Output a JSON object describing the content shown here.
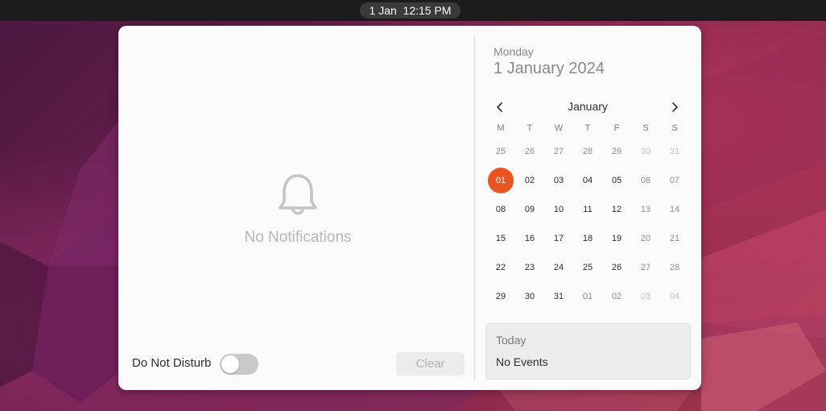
{
  "topbar": {
    "clock": "1 Jan  12:15 PM"
  },
  "notifications": {
    "empty_text": "No Notifications",
    "dnd_label": "Do Not Disturb",
    "dnd_enabled": false,
    "clear_label": "Clear"
  },
  "calendar": {
    "day_name": "Monday",
    "full_date": "1 January 2024",
    "month": "January",
    "weekdays": [
      "M",
      "T",
      "W",
      "T",
      "F",
      "S",
      "S"
    ],
    "weeks": [
      [
        "25",
        "26",
        "27",
        "28",
        "29",
        "30",
        "31"
      ],
      [
        "01",
        "02",
        "03",
        "04",
        "05",
        "06",
        "07"
      ],
      [
        "08",
        "09",
        "10",
        "11",
        "12",
        "13",
        "14"
      ],
      [
        "15",
        "16",
        "17",
        "18",
        "19",
        "20",
        "21"
      ],
      [
        "22",
        "23",
        "24",
        "25",
        "26",
        "27",
        "28"
      ],
      [
        "29",
        "30",
        "31",
        "01",
        "02",
        "03",
        "04"
      ]
    ],
    "selected_day": "01"
  },
  "events": {
    "title": "Today",
    "empty_text": "No Events"
  },
  "colors": {
    "accent": "#e95420",
    "panel_bg": "#fafafa",
    "topbar_bg": "#1c1c1c"
  }
}
